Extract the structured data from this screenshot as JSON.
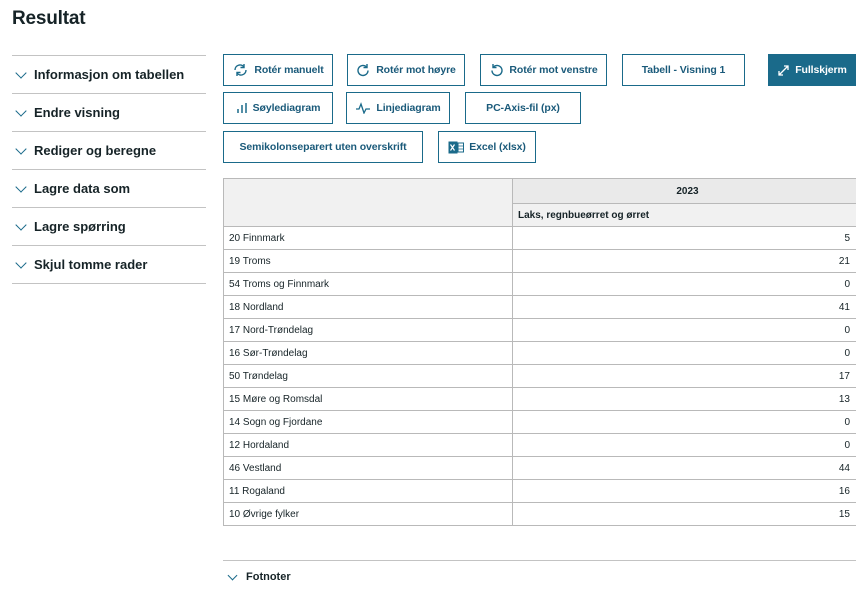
{
  "page_title": "Resultat",
  "sidebar": {
    "items": [
      {
        "label": "Informasjon om tabellen"
      },
      {
        "label": "Endre visning"
      },
      {
        "label": "Rediger og beregne"
      },
      {
        "label": "Lagre data som"
      },
      {
        "label": "Lagre spørring"
      },
      {
        "label": "Skjul tomme rader"
      }
    ]
  },
  "toolbar": {
    "rotate_manual": "Rotér manuelt",
    "rotate_right": "Rotér mot høyre",
    "rotate_left": "Rotér mot venstre",
    "table_view": "Tabell - Visning 1",
    "fullscreen": "Fullskjerm",
    "bar_chart": "Søylediagram",
    "line_chart": "Linjediagram",
    "pcaxis": "PC-Axis-fil (px)",
    "semicolon": "Semikolonseparert uten overskrift",
    "excel": "Excel (xlsx)"
  },
  "table": {
    "year": "2023",
    "measure": "Laks, regnbueørret og ørret",
    "rows": [
      {
        "label": "20 Finnmark",
        "value": "5"
      },
      {
        "label": "19 Troms",
        "value": "21"
      },
      {
        "label": "54 Troms og Finnmark",
        "value": "0"
      },
      {
        "label": "18 Nordland",
        "value": "41"
      },
      {
        "label": "17 Nord-Trøndelag",
        "value": "0"
      },
      {
        "label": "16 Sør-Trøndelag",
        "value": "0"
      },
      {
        "label": "50 Trøndelag",
        "value": "17"
      },
      {
        "label": "15 Møre og Romsdal",
        "value": "13"
      },
      {
        "label": "14 Sogn og Fjordane",
        "value": "0"
      },
      {
        "label": "12 Hordaland",
        "value": "0"
      },
      {
        "label": "46 Vestland",
        "value": "44"
      },
      {
        "label": "11 Rogaland",
        "value": "16"
      },
      {
        "label": "10 Øvrige fylker",
        "value": "15"
      }
    ]
  },
  "footnotes_label": "Fotnoter"
}
